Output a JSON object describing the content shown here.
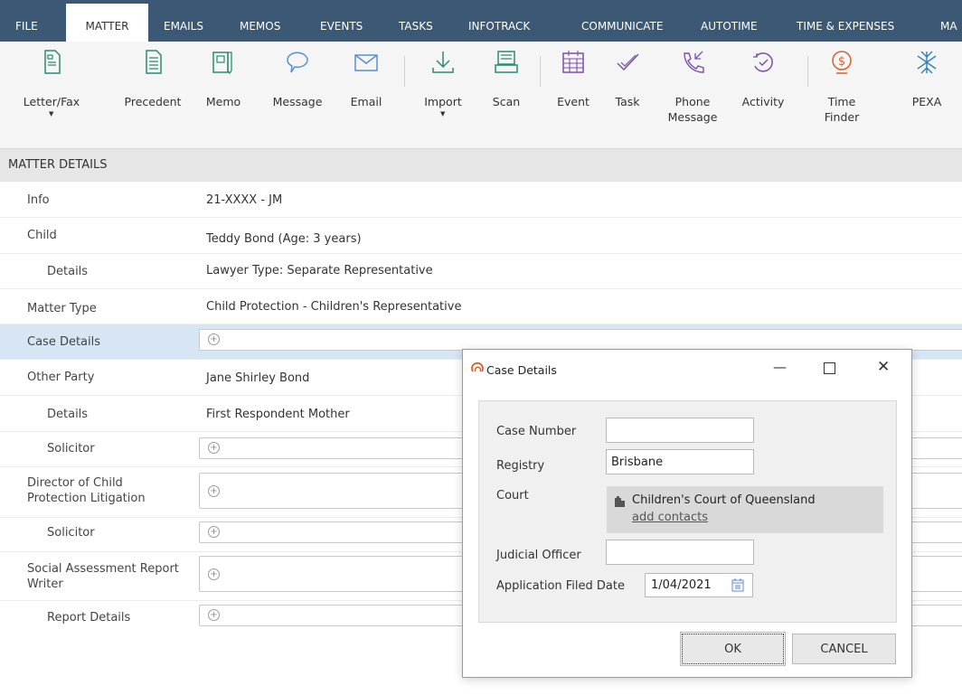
{
  "tabs": [
    "FILE",
    "MATTER",
    "EMAILS",
    "MEMOS",
    "EVENTS",
    "TASKS",
    "INFOTRACK",
    "COMMUNICATE",
    "AUTOTIME",
    "TIME & EXPENSES",
    "MA"
  ],
  "active_tab": "MATTER",
  "ribbon": {
    "letter_fax": "Letter/Fax",
    "precedent": "Precedent",
    "memo": "Memo",
    "message": "Message",
    "email": "Email",
    "import": "Import",
    "scan": "Scan",
    "event": "Event",
    "task": "Task",
    "phone_line1": "Phone",
    "phone_line2": "Message",
    "activity": "Activity",
    "time_line1": "Time",
    "time_line2": "Finder",
    "pexa": "PEXA"
  },
  "section_title": "MATTER DETAILS",
  "rows": {
    "info": {
      "label": "Info",
      "value": "21-XXXX - JM"
    },
    "child": {
      "label": "Child",
      "value": "Teddy Bond (Age: 3 years)"
    },
    "child_details": {
      "label": "Details",
      "value": "Lawyer Type: Separate Representative"
    },
    "matter_type": {
      "label": "Matter Type",
      "value": "Child Protection - Children's Representative"
    },
    "case_details": {
      "label": "Case Details"
    },
    "other_party": {
      "label": "Other Party",
      "value": "Jane Shirley Bond"
    },
    "other_details": {
      "label": "Details",
      "value": "First Respondent Mother"
    },
    "solicitor1": {
      "label": "Solicitor"
    },
    "director_line1": {
      "label": "Director of Child"
    },
    "director_line2": {
      "label": "Protection Litigation"
    },
    "solicitor2": {
      "label": "Solicitor"
    },
    "social_line1": {
      "label": "Social Assessment Report"
    },
    "social_line2": {
      "label": "Writer"
    },
    "report_details": {
      "label": "Report Details"
    }
  },
  "dialog": {
    "title": "Case Details",
    "case_number_label": "Case Number",
    "case_number_value": "",
    "registry_label": "Registry",
    "registry_value": "Brisbane",
    "court_label": "Court",
    "court_value": "Children's Court of Queensland",
    "court_link": "add contacts",
    "judicial_label": "Judicial Officer",
    "judicial_value": "",
    "filed_label": "Application Filed Date",
    "filed_value": "1/04/2021",
    "ok": "OK",
    "cancel": "CANCEL"
  },
  "colors": {
    "tabbar": "#3b5874",
    "accent_teal": "#2c8a74",
    "accent_purple": "#7b4fb0",
    "accent_orange": "#d9602a"
  }
}
